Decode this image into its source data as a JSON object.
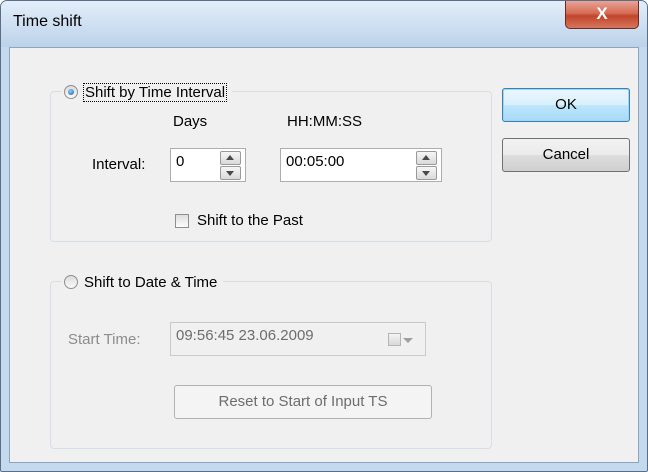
{
  "window": {
    "title": "Time shift",
    "close_glyph": "X"
  },
  "shift_interval": {
    "radio_label": "Shift by Time Interval",
    "selected": true,
    "days_header": "Days",
    "hms_header": "HH:MM:SS",
    "interval_label": "Interval:",
    "days_value": "0",
    "hms_value": "00:05:00",
    "past_label": "Shift to the Past",
    "past_checked": false
  },
  "shift_datetime": {
    "radio_label": "Shift to Date & Time",
    "selected": false,
    "start_time_label": "Start Time:",
    "start_time_value": "09:56:45 23.06.2009",
    "reset_label": "Reset to Start of Input TS"
  },
  "buttons": {
    "ok": "OK",
    "cancel": "Cancel"
  },
  "icons": [
    "close-icon",
    "spin-up-icon",
    "spin-down-icon",
    "calendar-icon",
    "dropdown-arrow-icon"
  ]
}
